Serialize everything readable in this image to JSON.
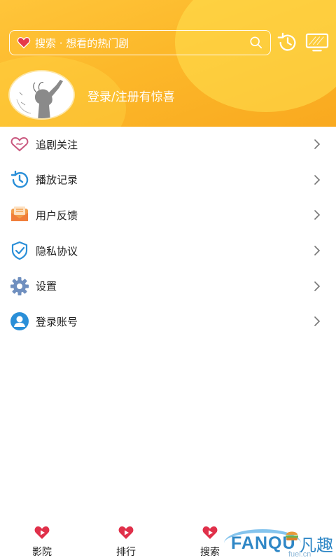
{
  "header": {
    "search_placeholder": "搜索 · 想看的热门剧",
    "login_prompt": "登录/注册有惊喜"
  },
  "menu": {
    "items": [
      {
        "label": "追剧关注",
        "icon": "heart-follow-icon"
      },
      {
        "label": "播放记录",
        "icon": "history-record-icon"
      },
      {
        "label": "用户反馈",
        "icon": "feedback-envelope-icon"
      },
      {
        "label": "隐私协议",
        "icon": "shield-check-icon"
      },
      {
        "label": "设置",
        "icon": "gear-icon"
      },
      {
        "label": "登录账号",
        "icon": "user-account-icon"
      }
    ]
  },
  "tabbar": {
    "tabs": [
      {
        "label": "影院"
      },
      {
        "label": "排行"
      },
      {
        "label": "搜索"
      }
    ]
  },
  "watermark": {
    "brand": "FANQU",
    "brand_cn": "凡趣",
    "url": "fuel.cn"
  },
  "colors": {
    "header_orange": "#fcb82a",
    "accent_red": "#e0304a",
    "icon_blue": "#2a8fd8",
    "icon_pink": "#c9577e"
  }
}
